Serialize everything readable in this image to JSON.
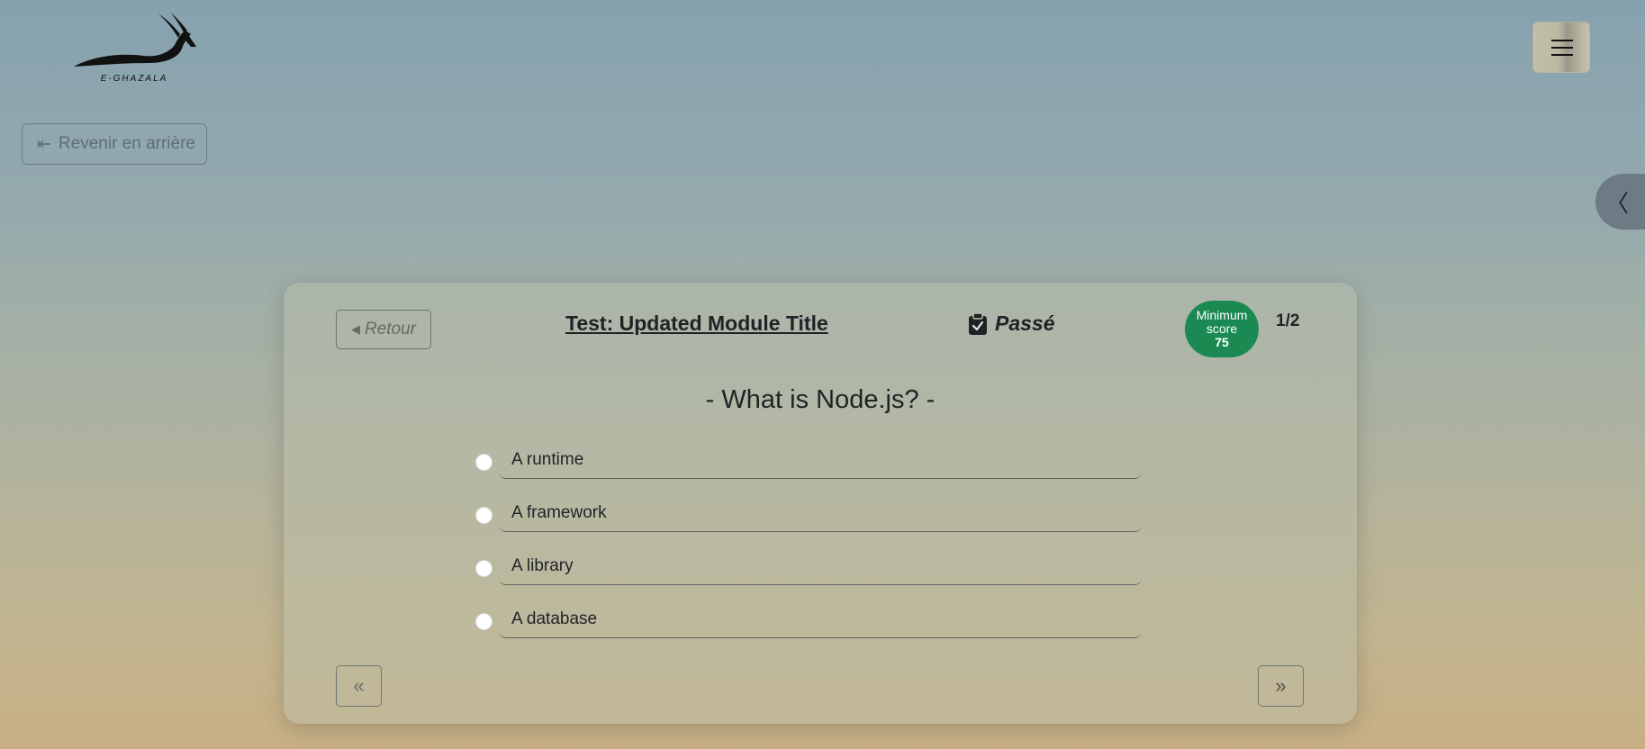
{
  "brand": {
    "logo_text": "E-GHAZALA"
  },
  "header": {
    "menu_icon": "hamburger-icon"
  },
  "back_link": {
    "icon": "arrow-left-bar-icon",
    "label": "Revenir en arrière"
  },
  "side_toggle": {
    "icon": "chevron-left-icon",
    "glyph": "〈"
  },
  "quiz": {
    "retour_label": "Retour",
    "retour_icon": "caret-left-icon",
    "title": "Test: Updated Module Title",
    "status_icon": "clipboard-check-icon",
    "status": "Passé",
    "min_score_label_1": "Minimum",
    "min_score_label_2": "score",
    "min_score_value": "75",
    "counter": "1/2",
    "question": "- What is Node.js? -",
    "options": [
      {
        "label": "A runtime",
        "selected": false
      },
      {
        "label": "A framework",
        "selected": false
      },
      {
        "label": "A library",
        "selected": false
      },
      {
        "label": "A database",
        "selected": false
      }
    ],
    "prev_icon": "double-chevron-left-icon",
    "next_icon": "double-chevron-right-icon"
  },
  "colors": {
    "min_score_bg": "#1a8a52",
    "side_tab_bg": "#6e7b85"
  }
}
